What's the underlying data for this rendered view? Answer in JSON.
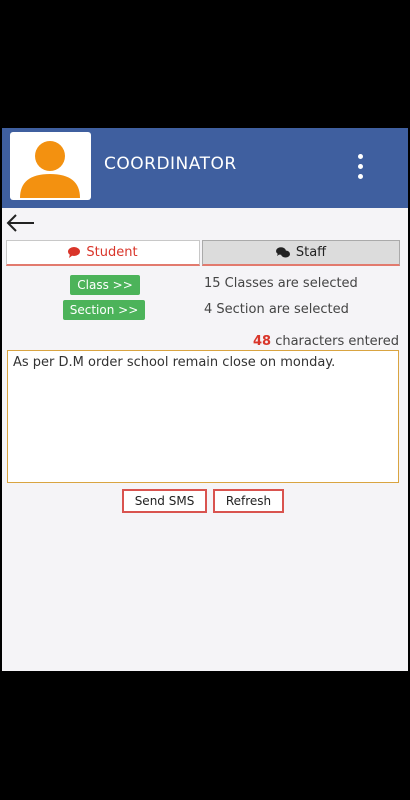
{
  "header": {
    "title": "COORDINATOR",
    "background": "#3f5f9f",
    "avatar_color": "#f39110"
  },
  "tabs": [
    {
      "label": "Student",
      "icon": "comment-icon",
      "active": true
    },
    {
      "label": "Staff",
      "icon": "comments-icon",
      "active": false
    }
  ],
  "selection": {
    "class_button": "Class >>",
    "class_status": "15 Classes are selected",
    "section_button": "Section >>",
    "section_status": "4 Section are selected"
  },
  "message": {
    "char_count": "48",
    "char_label": " characters entered",
    "text": "As per D.M order school remain close on monday."
  },
  "actions": {
    "send": "Send SMS",
    "refresh": "Refresh"
  }
}
